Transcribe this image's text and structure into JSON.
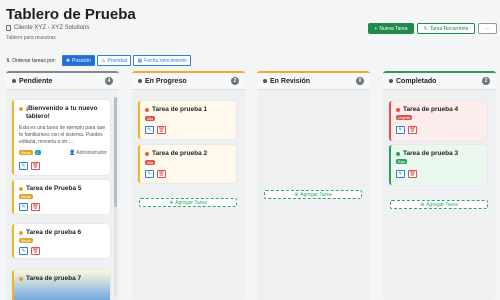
{
  "header": {
    "title": "Tablero de Prueba",
    "client": "Cliente XYZ - XYZ Solutions",
    "subtitle": "Tablero para muestras",
    "new_task_label": "Nueva Tarea",
    "recurring_label": "Tarea Recurrente",
    "more_label": "···"
  },
  "sort": {
    "label": "Ordenar tareas por:",
    "options": [
      "Posición",
      "Prioridad",
      "Fecha Vencimiento"
    ],
    "active": "Posición"
  },
  "columns": [
    {
      "title": "Pendiente",
      "count": "4",
      "color": "#888888",
      "cards": [
        {
          "title": "¡Bienvenido a tu nuevo tablero!",
          "description": "Esta es una tarea de ejemplo para que te familiarices con el sistema. Puedes editarla, moverla a otr ...",
          "assignee": "Administrador",
          "tags": [
            "Media",
            "1"
          ],
          "priority_color": "#e0a526"
        },
        {
          "title": "Tarea de Prueba 5",
          "tags": [
            "Media"
          ],
          "priority_color": "#e0a526"
        },
        {
          "title": "Tarea de prueba 6",
          "tags": [
            "Media"
          ],
          "priority_color": "#e0a526"
        },
        {
          "title": "Tarea de prueba 7",
          "tags": [],
          "priority_color": "#e0a526"
        }
      ]
    },
    {
      "title": "En Progreso",
      "count": "2",
      "color": "#f0a830",
      "cards": [
        {
          "title": "Tarea de prueba 1",
          "tags": [
            "Alta"
          ],
          "priority_color": "#e8662c"
        },
        {
          "title": "Tarea de prueba 2",
          "tags": [
            "Alta"
          ],
          "priority_color": "#e8662c"
        }
      ],
      "add_label": "Agregar Tarea"
    },
    {
      "title": "En Revisión",
      "count": "0",
      "color": "#f0a830",
      "cards": [],
      "add_label": "Agregar Tarea"
    },
    {
      "title": "Completado",
      "count": "2",
      "color": "#2e9a5c",
      "cards": [
        {
          "title": "Tarea de prueba 4",
          "tags": [
            "Urgente"
          ],
          "priority_color": "#d9534f"
        },
        {
          "title": "Tarea de prueba 3",
          "tags": [
            "Baja"
          ],
          "priority_color": "#2e9a5c"
        }
      ],
      "add_label": "Agregar Tarea"
    }
  ],
  "colors": {
    "primary_green": "#1f8a4c",
    "accent_blue": "#1f6fd8",
    "media": "#e0a526",
    "alta": "#e8662c",
    "urgente": "#d9534f",
    "baja": "#2e9a5c"
  }
}
